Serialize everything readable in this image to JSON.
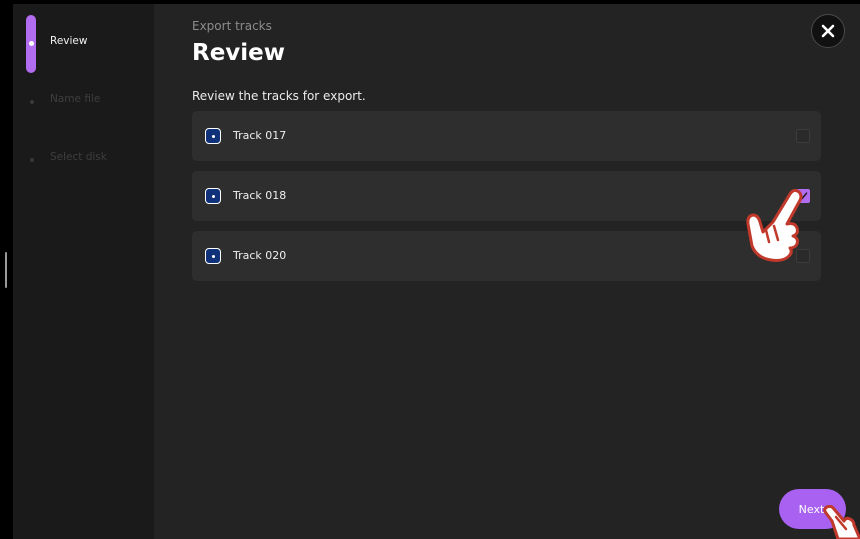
{
  "sidebar": {
    "steps": [
      {
        "label": "Review",
        "state": "active"
      },
      {
        "label": "Name file",
        "state": "inactive"
      },
      {
        "label": "Select disk",
        "state": "inactive"
      }
    ]
  },
  "header": {
    "kicker": "Export tracks",
    "title": "Review",
    "subtitle": "Review the tracks for export.",
    "close_icon": "close-icon"
  },
  "tracks": [
    {
      "name": "Track 017",
      "checked": false
    },
    {
      "name": "Track 018",
      "checked": true
    },
    {
      "name": "Track 020",
      "checked": false
    }
  ],
  "footer": {
    "next_label": "Next"
  },
  "colors": {
    "accent": "#b26cf0",
    "track_icon_fill": "#10327a",
    "pointer_outline": "#c0392b"
  }
}
